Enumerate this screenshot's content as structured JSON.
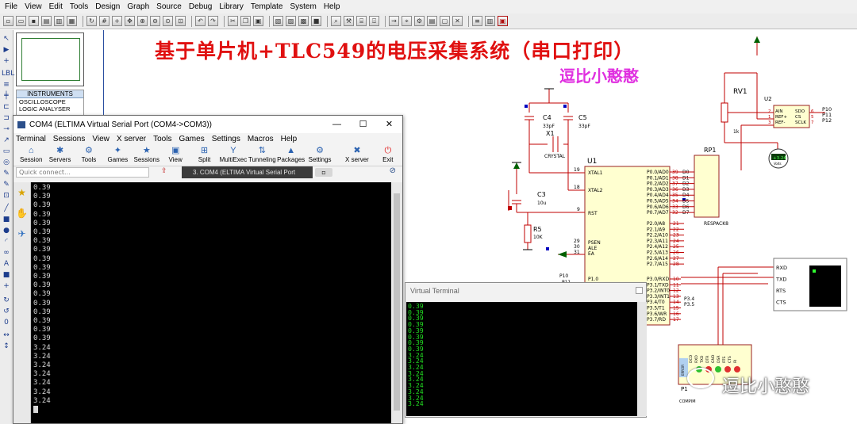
{
  "menu": [
    "File",
    "View",
    "Edit",
    "Tools",
    "Design",
    "Graph",
    "Source",
    "Debug",
    "Library",
    "Template",
    "System",
    "Help"
  ],
  "device_panel": {
    "header": "INSTRUMENTS",
    "items": [
      "OSCILLOSCOPE",
      "LOGIC ANALYSER"
    ]
  },
  "schematic": {
    "title": "基于单片机+TLC549的电压采集系统（串口打印）",
    "author": "逗比小憨憨",
    "labels": {
      "c4": "C4",
      "c4_val": "33pF",
      "c5": "C5",
      "c5_val": "33pF",
      "x1": "X1",
      "x1_val": "CRYSTAL",
      "c3": "C3",
      "c3_val": "10u",
      "r5": "R5",
      "r5_val": "10K",
      "u1": "U1",
      "rp1": "RP1",
      "rp1_val": "RESPACK8",
      "rv1": "RV1",
      "rv1_val": "1k",
      "u2": "U2",
      "p1": "P1",
      "p1_val": "COMPIM",
      "error": "ERROR",
      "pin19": "19",
      "pin18": "18",
      "pin9": "9",
      "pin29": "29",
      "pin30": "30",
      "pin31": "31",
      "xtal1": "XTAL1",
      "xtal2": "XTAL2",
      "rst": "RST",
      "psen": "PSEN",
      "ale": "ALE",
      "ea": "EA",
      "p10": "P10",
      "p11": "P11",
      "p1_0": "P1.0",
      "port0": [
        "P0.0/AD0",
        "P0.1/AD1",
        "P0.2/AD2",
        "P0.3/AD3",
        "P0.4/AD4",
        "P0.5/AD5",
        "P0.6/AD6",
        "P0.7/AD7"
      ],
      "port0_pins": [
        "39",
        "38",
        "37",
        "36",
        "35",
        "34",
        "33",
        "32"
      ],
      "port0_nets": [
        "D0",
        "D1",
        "D2",
        "D3",
        "D4",
        "D5",
        "D6",
        "D7"
      ],
      "rp_pins": [
        "2",
        "3",
        "4",
        "5",
        "6",
        "7",
        "8",
        "9"
      ],
      "port2": [
        "P2.0/A8",
        "P2.1/A9",
        "P2.2/A10",
        "P2.3/A11",
        "P2.4/A12",
        "P2.5/A13",
        "P2.6/A14",
        "P2.7/A15"
      ],
      "port2_pins": [
        "21",
        "22",
        "23",
        "24",
        "25",
        "26",
        "27",
        "28"
      ],
      "port3": [
        "P3.0/RXD",
        "P3.1/TXD",
        "P3.2/INT0",
        "P3.3/INT1",
        "P3.4/T0",
        "P3.5/T1",
        "P3.6/WR",
        "P3.7/RD"
      ],
      "port3_pins": [
        "10",
        "11",
        "12",
        "13",
        "14",
        "15",
        "16",
        "17"
      ],
      "p34": "P3.4",
      "p35": "P3.5",
      "adc_pins": [
        "AIN",
        "REF+",
        "REF-"
      ],
      "adc_pins_r": [
        "SDO",
        "CS",
        "SCLK"
      ],
      "adc_nums": [
        "2",
        "1",
        "3"
      ],
      "adc_nums_r": [
        "6",
        "5",
        "7"
      ],
      "adc_nets": [
        "P10",
        "P11",
        "P12"
      ],
      "vt_pins": [
        "RXD",
        "TXD",
        "RTS",
        "CTS"
      ],
      "meter_val": "+3.24",
      "meter_unit": "Volts",
      "db9": [
        "DCD",
        "RXD",
        "TXD",
        "DTR",
        "GND",
        "DSR",
        "RTS",
        "CTS",
        "RI"
      ]
    }
  },
  "com4": {
    "title": "COM4  (ELTIMA Virtual Serial Port (COM4->COM3))",
    "minimize": "—",
    "maximize": "☐",
    "close": "✕",
    "menu": [
      "Terminal",
      "Sessions",
      "View",
      "X server",
      "Tools",
      "Games",
      "Settings",
      "Macros",
      "Help"
    ],
    "toolbar": [
      {
        "label": "Session",
        "icon": "⌂"
      },
      {
        "label": "Servers",
        "icon": "✱"
      },
      {
        "label": "Tools",
        "icon": "⚙"
      },
      {
        "label": "Games",
        "icon": "✦"
      },
      {
        "label": "Sessions",
        "icon": "★"
      },
      {
        "label": "View",
        "icon": "▣"
      },
      {
        "label": "Split",
        "icon": "⊞"
      },
      {
        "label": "MultiExec",
        "icon": "Y"
      },
      {
        "label": "Tunneling",
        "icon": "⇅"
      },
      {
        "label": "Packages",
        "icon": "▲"
      },
      {
        "label": "Settings",
        "icon": "⚙"
      }
    ],
    "xserver_label": "X server",
    "exit_label": "Exit",
    "quick_connect_placeholder": "Quick connect...",
    "active_tab": "3. COM4  (ELTIMA Virtual Serial Port",
    "lines": [
      "0.39",
      "0.39",
      "0.39",
      "0.39",
      "0.39",
      "0.39",
      "0.39",
      "0.39",
      "0.39",
      "0.39",
      "0.39",
      "0.39",
      "0.39",
      "0.39",
      "0.39",
      "0.39",
      "0.39",
      "0.39",
      "3.24",
      "3.24",
      "3.24",
      "3.24",
      "3.24",
      "3.24",
      "3.24"
    ]
  },
  "virtual_terminal": {
    "title": "Virtual Terminal",
    "lines": [
      "0.39",
      "0.39",
      "0.39",
      "0.39",
      "0.39",
      "0.39",
      "0.39",
      "0.39",
      "3.24",
      "3.24",
      "3.24",
      "3.24",
      "3.24",
      "3.24",
      "3.24",
      "3.24",
      "3.24"
    ]
  },
  "watermark": "逗比小憨憨",
  "colors": {
    "title": "#e01010",
    "author": "#e030e0",
    "schematic_wire": "#c00000",
    "bus": "#00007a",
    "pin_blue": "#0000c0"
  }
}
